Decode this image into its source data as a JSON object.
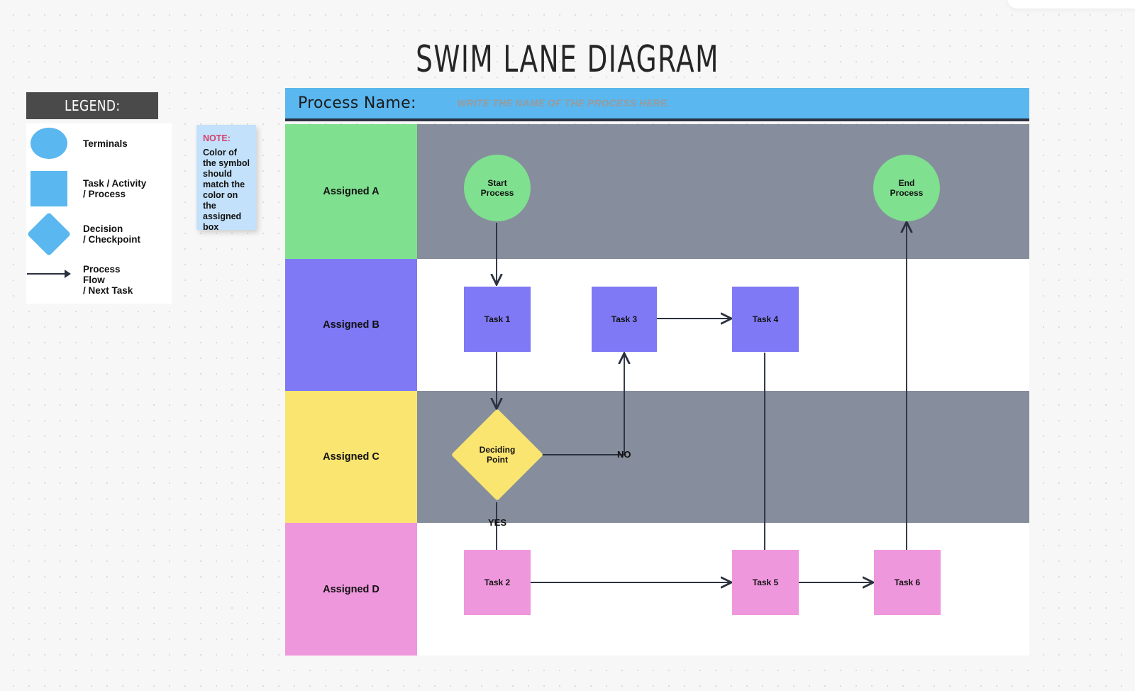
{
  "page": {
    "title": "SWIM LANE DIAGRAM"
  },
  "legend": {
    "heading": "LEGEND:",
    "items": [
      {
        "shape": "circle",
        "label": "Terminals"
      },
      {
        "shape": "rect",
        "label": "Task / Activity\n/ Process"
      },
      {
        "shape": "diamond",
        "label": "Decision\n/ Checkpoint"
      },
      {
        "shape": "arrow",
        "label": "Process\nFlow\n/ Next Task"
      }
    ],
    "item_labels": {
      "terminals": "Terminals",
      "task_l1": "Task / Activity",
      "task_l2": "/ Process",
      "decision_l1": "Decision",
      "decision_l2": "/ Checkpoint",
      "flow_l1": "Process",
      "flow_l2": "Flow",
      "flow_l3": "/ Next Task"
    }
  },
  "note": {
    "title": "NOTE:",
    "body": "Color of the symbol should match the color on the assigned box"
  },
  "process_header": {
    "label": "Process Name:",
    "placeholder": "WRITE THE NAME OF THE PROCESS HERE."
  },
  "lanes": [
    {
      "label": "Assigned A",
      "color": "#7fe08f",
      "body_color": "#868d9c"
    },
    {
      "label": "Assigned B",
      "color": "#7f79f5",
      "body_color": "#ffffff"
    },
    {
      "label": "Assigned C",
      "color": "#fbe571",
      "body_color": "#868d9c"
    },
    {
      "label": "Assigned D",
      "color": "#ef97dd",
      "body_color": "#ffffff"
    }
  ],
  "nodes": [
    {
      "id": "start",
      "type": "terminal",
      "label": "Start\nProcess",
      "l1": "Start",
      "l2": "Process",
      "color": "#7fe08f",
      "lane": "Assigned A"
    },
    {
      "id": "end",
      "type": "terminal",
      "label": "End\nProcess",
      "l1": "End",
      "l2": "Process",
      "color": "#7fe08f",
      "lane": "Assigned A"
    },
    {
      "id": "task1",
      "type": "task",
      "label": "Task 1",
      "color": "#7f79f5",
      "lane": "Assigned B"
    },
    {
      "id": "task3",
      "type": "task",
      "label": "Task 3",
      "color": "#7f79f5",
      "lane": "Assigned B"
    },
    {
      "id": "task4",
      "type": "task",
      "label": "Task 4",
      "color": "#7f79f5",
      "lane": "Assigned B"
    },
    {
      "id": "decision",
      "type": "decision",
      "label": "Deciding\nPoint",
      "l1": "Deciding",
      "l2": "Point",
      "color": "#fbe571",
      "lane": "Assigned C"
    },
    {
      "id": "task2",
      "type": "task",
      "label": "Task 2",
      "color": "#ef97dd",
      "lane": "Assigned D"
    },
    {
      "id": "task5",
      "type": "task",
      "label": "Task 5",
      "color": "#ef97dd",
      "lane": "Assigned D"
    },
    {
      "id": "task6",
      "type": "task",
      "label": "Task 6",
      "color": "#ef97dd",
      "lane": "Assigned D"
    }
  ],
  "edge_labels": {
    "no": "NO",
    "yes": "YES"
  },
  "colors": {
    "header_blue": "#5ab7ef",
    "legend_blue": "#5ab7ef",
    "legend_head_bg": "#4a4a4a",
    "note_bg": "#c3e1fa",
    "note_accent": "#d64070",
    "lane_gray": "#868d9c",
    "stroke": "#2b3140",
    "canvas": "#f7f7f7"
  }
}
